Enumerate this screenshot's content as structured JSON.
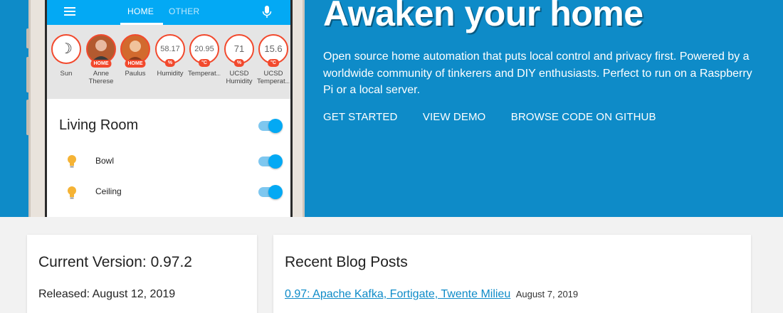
{
  "phone": {
    "tabs": [
      "HOME",
      "OTHER"
    ],
    "badges": [
      {
        "value": "",
        "icon": "moon-icon",
        "unit": "",
        "label": "Sun"
      },
      {
        "value": "",
        "icon": "person-photo",
        "unit": "HOME",
        "label": "Anne Therese"
      },
      {
        "value": "",
        "icon": "person-photo",
        "unit": "HOME",
        "label": "Paulus"
      },
      {
        "value": "58.17",
        "unit": "%",
        "label": "Humidity"
      },
      {
        "value": "20.95",
        "unit": "°C",
        "label": "Temperat..."
      },
      {
        "value": "71",
        "unit": "%",
        "label": "UCSD Humidity"
      },
      {
        "value": "15.6",
        "unit": "°C",
        "label": "UCSD Temperat..."
      }
    ],
    "room": {
      "title": "Living Room",
      "rows": [
        {
          "label": "Bowl",
          "on": true
        },
        {
          "label": "Ceiling",
          "on": true
        }
      ]
    },
    "accent": "#03a9f4",
    "badge_color": "#f2492d"
  },
  "hero": {
    "title": "Awaken your home",
    "description": "Open source home automation that puts local control and privacy first. Powered by a worldwide community of tinkerers and DIY enthusiasts. Perfect to run on a Raspberry Pi or a local server.",
    "links": [
      "GET STARTED",
      "VIEW DEMO",
      "BROWSE CODE ON GITHUB"
    ],
    "background": "#0e8bc8"
  },
  "version_card": {
    "title": "Current Version: 0.97.2",
    "released": "Released: August 12, 2019"
  },
  "blog_card": {
    "title": "Recent Blog Posts",
    "post_title": "0.97: Apache Kafka, Fortigate, Twente Milieu",
    "post_date": "August 7, 2019"
  }
}
